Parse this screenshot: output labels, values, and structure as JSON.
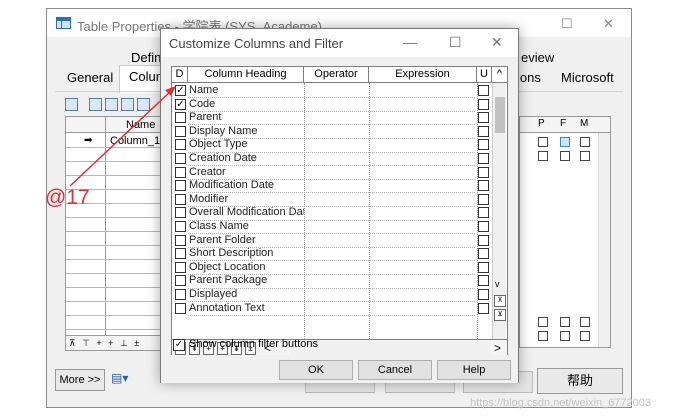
{
  "back_window": {
    "title": "Table Properties - 学院表 (SYS_Academe)",
    "tabs_row1": [
      "Defini",
      "eview"
    ],
    "tabs_row2": [
      "General",
      "Colum",
      "ions",
      "Microsoft"
    ],
    "grid_header": "Name",
    "grid_row1": "Column_1",
    "right_headers": [
      "P",
      "F",
      "M"
    ],
    "more_button": "More >>",
    "help_button": "帮助",
    "grid_nav": "⊼ ⊤ + + ⊥ ±"
  },
  "dialog": {
    "title": "Customize Columns and Filter",
    "columns": {
      "d": "D",
      "heading": "Column Heading",
      "operator": "Operator",
      "expression": "Expression",
      "u": "U"
    },
    "rows": [
      {
        "label": "Name",
        "checked": true
      },
      {
        "label": "Code",
        "checked": true
      },
      {
        "label": "Parent",
        "checked": false
      },
      {
        "label": "Display Name",
        "checked": false
      },
      {
        "label": "Object Type",
        "checked": false
      },
      {
        "label": "Creation Date",
        "checked": false
      },
      {
        "label": "Creator",
        "checked": false
      },
      {
        "label": "Modification Date",
        "checked": false
      },
      {
        "label": "Modifier",
        "checked": false
      },
      {
        "label": "Overall Modification Dat",
        "checked": false
      },
      {
        "label": "Class Name",
        "checked": false
      },
      {
        "label": "Parent Folder",
        "checked": false
      },
      {
        "label": "Short Description",
        "checked": false
      },
      {
        "label": "Object Location",
        "checked": false
      },
      {
        "label": "Parent Package",
        "checked": false
      },
      {
        "label": "Displayed",
        "checked": false
      },
      {
        "label": "Annotation Text",
        "checked": false
      }
    ],
    "show_filter_label": "Show column filter buttons",
    "show_filter_checked": true,
    "ok": "OK",
    "cancel": "Cancel",
    "help": "Help"
  },
  "annotation": {
    "label": "@17",
    "color": "#e0303a"
  },
  "watermark": "https://blog.csdn.net/weixin_6772003"
}
